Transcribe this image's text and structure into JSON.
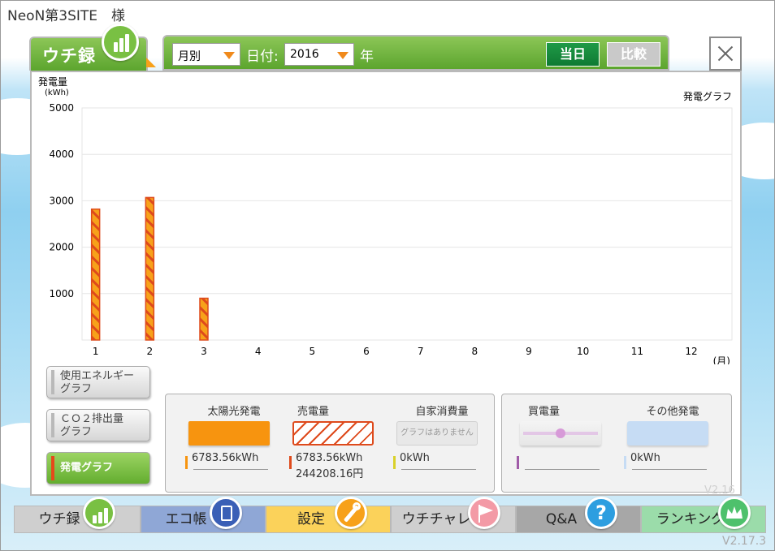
{
  "site": {
    "name": "NeoN第3SITE　様"
  },
  "app_tab": {
    "label": "ウチ録"
  },
  "toolbar": {
    "period_select": "月別",
    "date_label": "日付:",
    "year_select": "2016",
    "year_unit": "年",
    "today_button": "当日",
    "compare_button": "比較"
  },
  "chart_data": {
    "type": "bar",
    "title": "発電グラフ",
    "ylabel": "発電量",
    "yunit": "(kWh)",
    "xunit": "(月)",
    "categories": [
      "1",
      "2",
      "3",
      "4",
      "5",
      "6",
      "7",
      "8",
      "9",
      "10",
      "11",
      "12"
    ],
    "series": [
      {
        "values": [
          2820,
          3070,
          900,
          0,
          0,
          0,
          0,
          0,
          0,
          0,
          0,
          0
        ]
      }
    ],
    "ylim": [
      0,
      5000
    ],
    "yticks": [
      1000,
      2000,
      3000,
      4000,
      5000
    ],
    "grid": true,
    "bar_color": "#f7a11a",
    "hatch_color": "#de4a1c"
  },
  "side_buttons": [
    {
      "label_line1": "使用エネルギー",
      "label_line2": "グラフ"
    },
    {
      "label_line1": "ＣＯ２排出量",
      "label_line2": "グラフ"
    },
    {
      "label": "発電グラフ"
    }
  ],
  "legend": {
    "solar": {
      "title": "太陽光発電",
      "value": "6783.56kWh",
      "color": "#f7940f"
    },
    "sell": {
      "title": "売電量",
      "value": "6783.56kWh",
      "value2": "244208.16円",
      "color": "#de4a1c"
    },
    "self": {
      "title": "自家消費量",
      "placeholder": "グラフはありません",
      "value": "0kWh",
      "color": "#d9d12a"
    },
    "buy": {
      "title": "買電量",
      "value": "",
      "color": "#a05ba8"
    },
    "other": {
      "title": "その他発電",
      "value": "0kWh",
      "color": "#c6dcf4"
    }
  },
  "nav": [
    {
      "label": "ウチ録",
      "color": "#cfcfcf",
      "icon_color": "#79c043"
    },
    {
      "label": "エコ帳",
      "color": "#8fa7d6",
      "icon_color": "#3a5fb6"
    },
    {
      "label": "設定",
      "color": "#fbd25a",
      "icon_color": "#f7a11a"
    },
    {
      "label": "ウチチャレ",
      "color": "#cfcfcf",
      "icon_color": "#f39aa6"
    },
    {
      "label": "Q&A",
      "color": "#a7a7a7",
      "icon_color": "#2d9ee0"
    },
    {
      "label": "ランキング",
      "color": "#9bdcaa",
      "icon_color": "#4ec16c"
    }
  ],
  "version": "V2.17.3",
  "version_bg": "V2.16"
}
